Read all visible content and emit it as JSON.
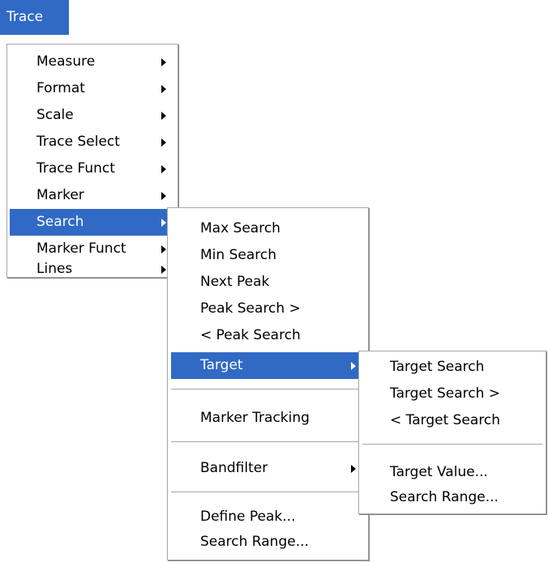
{
  "menubar": {
    "title": "Trace"
  },
  "trace_menu": {
    "items": [
      {
        "label": "Measure",
        "has_submenu": true
      },
      {
        "label": "Format",
        "has_submenu": true
      },
      {
        "label": "Scale",
        "has_submenu": true
      },
      {
        "label": "Trace Select",
        "has_submenu": true
      },
      {
        "label": "Trace Funct",
        "has_submenu": true
      },
      {
        "label": "Marker",
        "has_submenu": true
      },
      {
        "label": "Search",
        "has_submenu": true,
        "highlighted": true
      },
      {
        "label": "Marker Funct",
        "has_submenu": true
      },
      {
        "label": "Lines",
        "has_submenu": true
      }
    ]
  },
  "search_menu": {
    "items": [
      {
        "label": "Max Search"
      },
      {
        "label": "Min Search"
      },
      {
        "label": "Next Peak"
      },
      {
        "label": "Peak Search >"
      },
      {
        "label": "< Peak Search"
      },
      {
        "label": "Target",
        "has_submenu": true,
        "highlighted": true
      },
      {
        "label": "Marker Tracking"
      },
      {
        "label": "Bandfilter",
        "has_submenu": true
      },
      {
        "label": "Define Peak..."
      },
      {
        "label": "Search Range..."
      }
    ]
  },
  "target_menu": {
    "items": [
      {
        "label": "Target Search"
      },
      {
        "label": "Target Search >"
      },
      {
        "label": "< Target Search"
      },
      {
        "label": "Target Value..."
      },
      {
        "label": "Search Range..."
      }
    ]
  },
  "colors": {
    "highlight": "#316ac5",
    "menu_background": "#ffffff",
    "menu_border": "#a6a6a6"
  }
}
